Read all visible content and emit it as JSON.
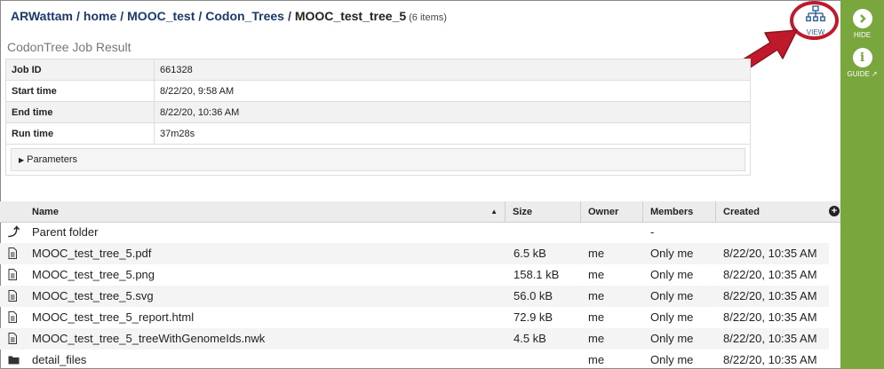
{
  "breadcrumb": {
    "items": [
      "ARWattam",
      "home",
      "MOOC_test",
      "Codon_Trees"
    ],
    "current": "MOOC_test_tree_5",
    "count": "(6 items)"
  },
  "toolbar": {
    "view_label": "VIEW"
  },
  "sidebar": {
    "hide_label": "HIDE",
    "guide_label": "GUIDE"
  },
  "job": {
    "title": "CodonTree Job Result",
    "rows": [
      {
        "key": "Job ID",
        "value": "661328"
      },
      {
        "key": "Start time",
        "value": "8/22/20, 9:58 AM"
      },
      {
        "key": "End time",
        "value": "8/22/20, 10:36 AM"
      },
      {
        "key": "Run time",
        "value": "37m28s"
      }
    ],
    "parameters_label": "Parameters"
  },
  "grid": {
    "columns": {
      "name": "Name",
      "size": "Size",
      "owner": "Owner",
      "members": "Members",
      "created": "Created"
    },
    "parent": {
      "name": "Parent folder",
      "members": "-"
    },
    "files": [
      {
        "name": "MOOC_test_tree_5.pdf",
        "size": "6.5 kB",
        "owner": "me",
        "members": "Only me",
        "created": "8/22/20, 10:35 AM"
      },
      {
        "name": "MOOC_test_tree_5.png",
        "size": "158.1 kB",
        "owner": "me",
        "members": "Only me",
        "created": "8/22/20, 10:35 AM"
      },
      {
        "name": "MOOC_test_tree_5.svg",
        "size": "56.0 kB",
        "owner": "me",
        "members": "Only me",
        "created": "8/22/20, 10:35 AM"
      },
      {
        "name": "MOOC_test_tree_5_report.html",
        "size": "72.9 kB",
        "owner": "me",
        "members": "Only me",
        "created": "8/22/20, 10:35 AM"
      },
      {
        "name": "MOOC_test_tree_5_treeWithGenomeIds.nwk",
        "size": "4.5 kB",
        "owner": "me",
        "members": "Only me",
        "created": "8/22/20, 10:35 AM"
      }
    ],
    "folder": {
      "name": "detail_files",
      "size": "",
      "owner": "me",
      "members": "Only me",
      "created": "8/22/20, 10:35 AM"
    }
  },
  "colors": {
    "sidebar": "#7aa63e",
    "link": "#1a3a6b",
    "highlight": "#c0192c"
  }
}
